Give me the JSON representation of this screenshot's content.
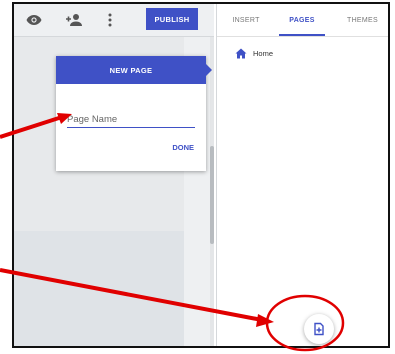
{
  "toolbar": {
    "icons": [
      "eye-icon",
      "add-person-icon",
      "more-vert-icon"
    ],
    "publish_label": "PUBLISH"
  },
  "tabs": [
    {
      "label": "INSERT",
      "active": false
    },
    {
      "label": "PAGES",
      "active": true
    },
    {
      "label": "THEMES",
      "active": false
    }
  ],
  "pages_panel": {
    "home_label": "Home",
    "home_icon": "home-icon",
    "add_page_icon": "add-page-icon"
  },
  "new_page_dialog": {
    "title": "NEW PAGE",
    "input_placeholder": "Page Name",
    "input_value": "",
    "done_label": "DONE"
  },
  "colors": {
    "accent": "#3f51c6",
    "annotation": "#e00000"
  }
}
